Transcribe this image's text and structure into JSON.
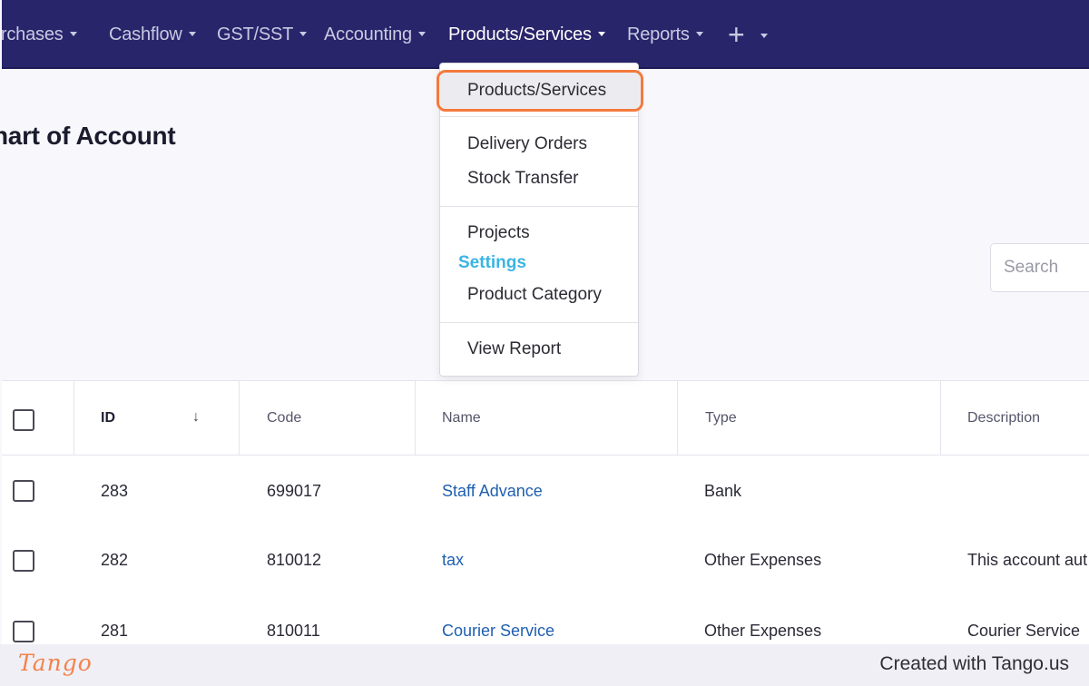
{
  "nav": {
    "items": [
      {
        "label": "urchases"
      },
      {
        "label": "Cashflow"
      },
      {
        "label": "GST/SST"
      },
      {
        "label": "Accounting"
      },
      {
        "label": "Products/Services",
        "active": true
      },
      {
        "label": "Reports"
      }
    ],
    "plus_label": "+"
  },
  "page": {
    "title": "hart of Account"
  },
  "search": {
    "placeholder": "Search"
  },
  "dropdown": {
    "items": [
      {
        "label": "Products/Services",
        "highlighted": true
      },
      {
        "label": "Delivery Orders"
      },
      {
        "label": "Stock Transfer"
      },
      {
        "label": "Projects"
      },
      {
        "label": "Product Category"
      },
      {
        "label": "View Report"
      }
    ],
    "section_label": "Settings"
  },
  "table": {
    "columns": [
      "ID",
      "Code",
      "Name",
      "Type",
      "Description"
    ],
    "sort_indicator": "↓",
    "rows": [
      {
        "id": "283",
        "code": "699017",
        "name": "Staff Advance",
        "type": "Bank",
        "description": ""
      },
      {
        "id": "282",
        "code": "810012",
        "name": "tax",
        "type": "Other Expenses",
        "description": "This account aut"
      },
      {
        "id": "281",
        "code": "810011",
        "name": "Courier Service",
        "type": "Other Expenses",
        "description": "Courier Service"
      }
    ]
  },
  "footer": {
    "logo": "Tango",
    "text": "Created with Tango.us"
  },
  "colors": {
    "nav_bg": "#29256b",
    "highlight_outline": "#f47a3d",
    "section_label": "#3bb4e3",
    "link": "#1f5fb0"
  }
}
